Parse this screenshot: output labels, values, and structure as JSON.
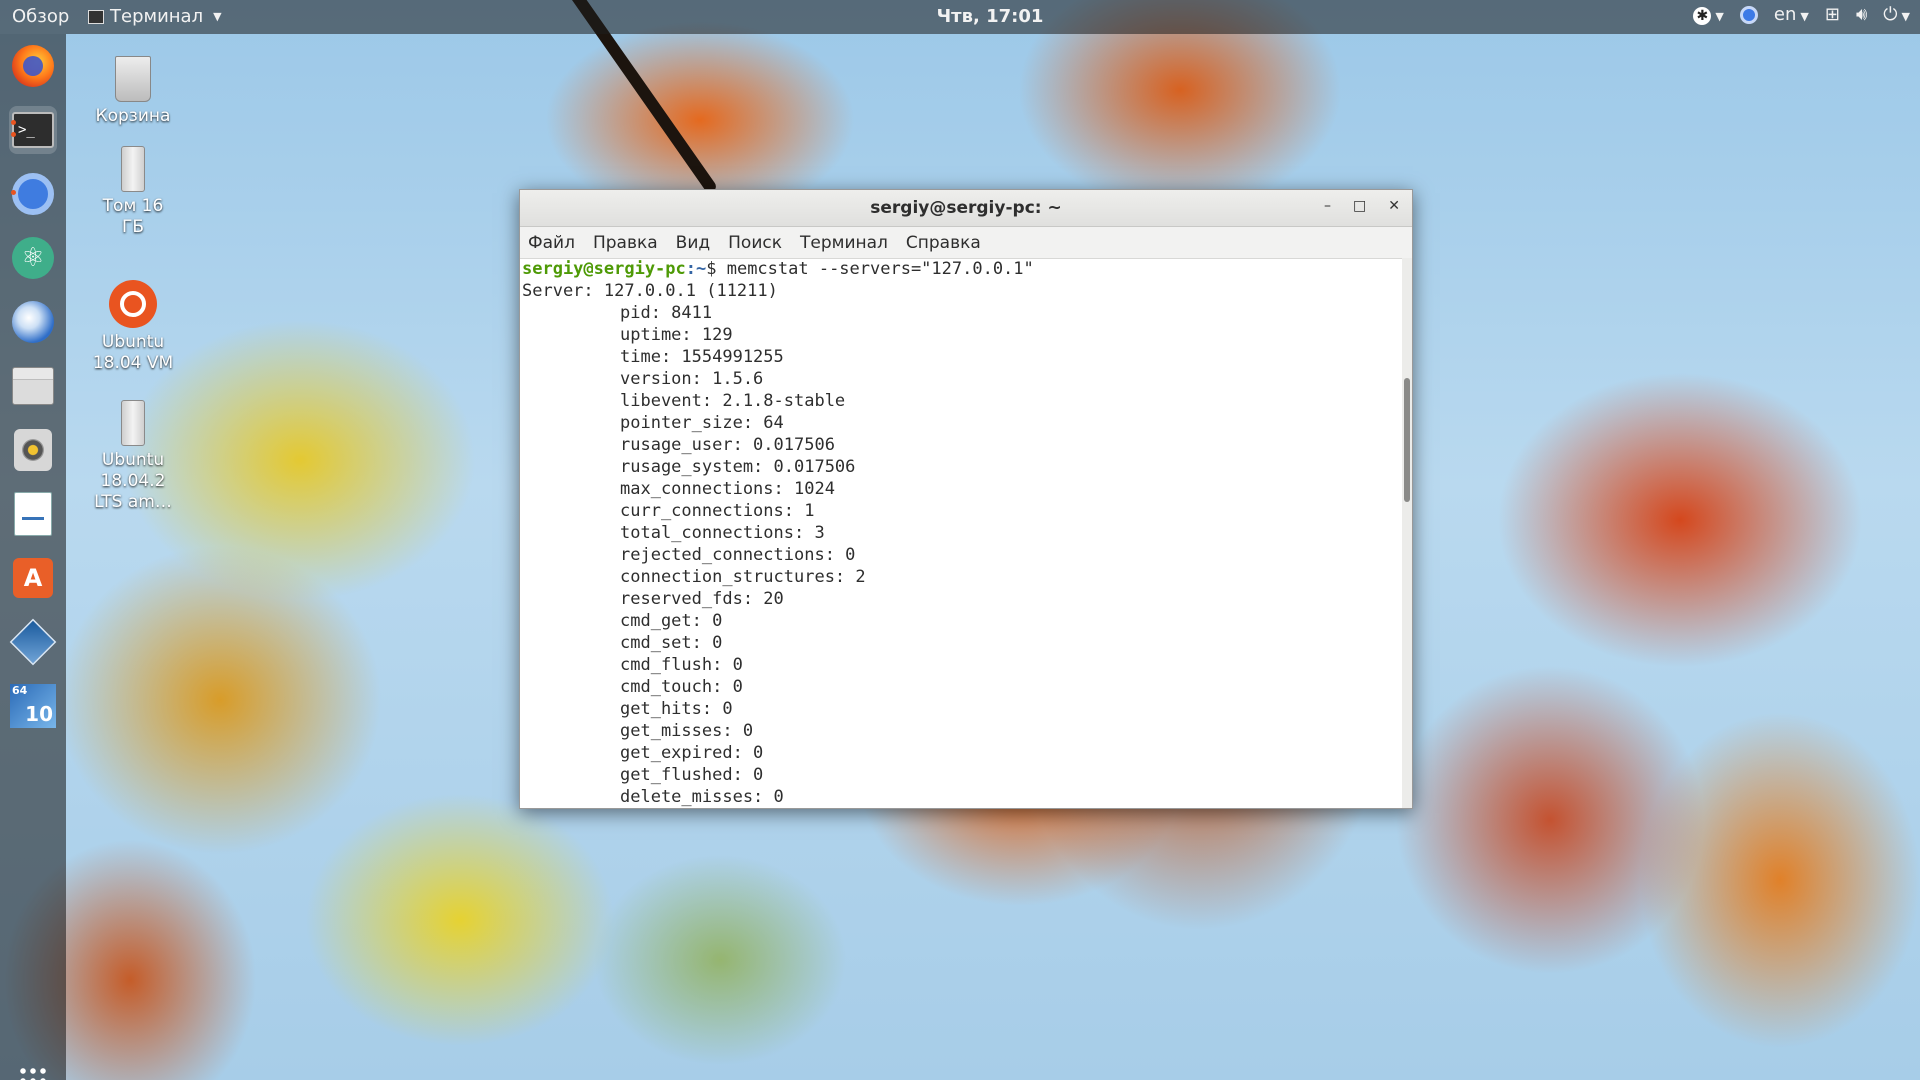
{
  "topbar": {
    "activities": "Обзор",
    "app_name": "Терминал",
    "clock": "Чтв, 17:01",
    "lang": "en"
  },
  "dock": {
    "items": [
      "firefox-icon",
      "terminal-icon",
      "chromium-icon",
      "atom-icon",
      "thunderbird-icon",
      "files-icon",
      "rhythmbox-icon",
      "writer-icon",
      "software-center-icon",
      "virtualbox-icon",
      "windows10-vm-icon"
    ],
    "win10_badge_top": "64",
    "win10_badge_main": "10"
  },
  "desktop": {
    "icons": [
      {
        "label": "Корзина"
      },
      {
        "label": "Том 16 ГБ"
      },
      {
        "label": "Ubuntu 18.04 VM"
      },
      {
        "label": "Ubuntu 18.04.2 LTS am…"
      }
    ]
  },
  "terminal": {
    "title": "sergiy@sergiy-pc: ~",
    "menu": [
      "Файл",
      "Правка",
      "Вид",
      "Поиск",
      "Терминал",
      "Справка"
    ],
    "prompt_user": "sergiy@sergiy-pc",
    "prompt_path": ":~",
    "command": "$ memcstat --servers=\"127.0.0.1\"",
    "server_line": "Server: 127.0.0.1 (11211)",
    "stats": [
      "pid: 8411",
      "uptime: 129",
      "time: 1554991255",
      "version: 1.5.6",
      "libevent: 2.1.8-stable",
      "pointer_size: 64",
      "rusage_user: 0.017506",
      "rusage_system: 0.017506",
      "max_connections: 1024",
      "curr_connections: 1",
      "total_connections: 3",
      "rejected_connections: 0",
      "connection_structures: 2",
      "reserved_fds: 20",
      "cmd_get: 0",
      "cmd_set: 0",
      "cmd_flush: 0",
      "cmd_touch: 0",
      "get_hits: 0",
      "get_misses: 0",
      "get_expired: 0",
      "get_flushed: 0",
      "delete_misses: 0"
    ]
  },
  "colors": {
    "prompt_user": "#4e9a06",
    "prompt_path": "#3465a4",
    "ubuntu_orange": "#e95420"
  }
}
